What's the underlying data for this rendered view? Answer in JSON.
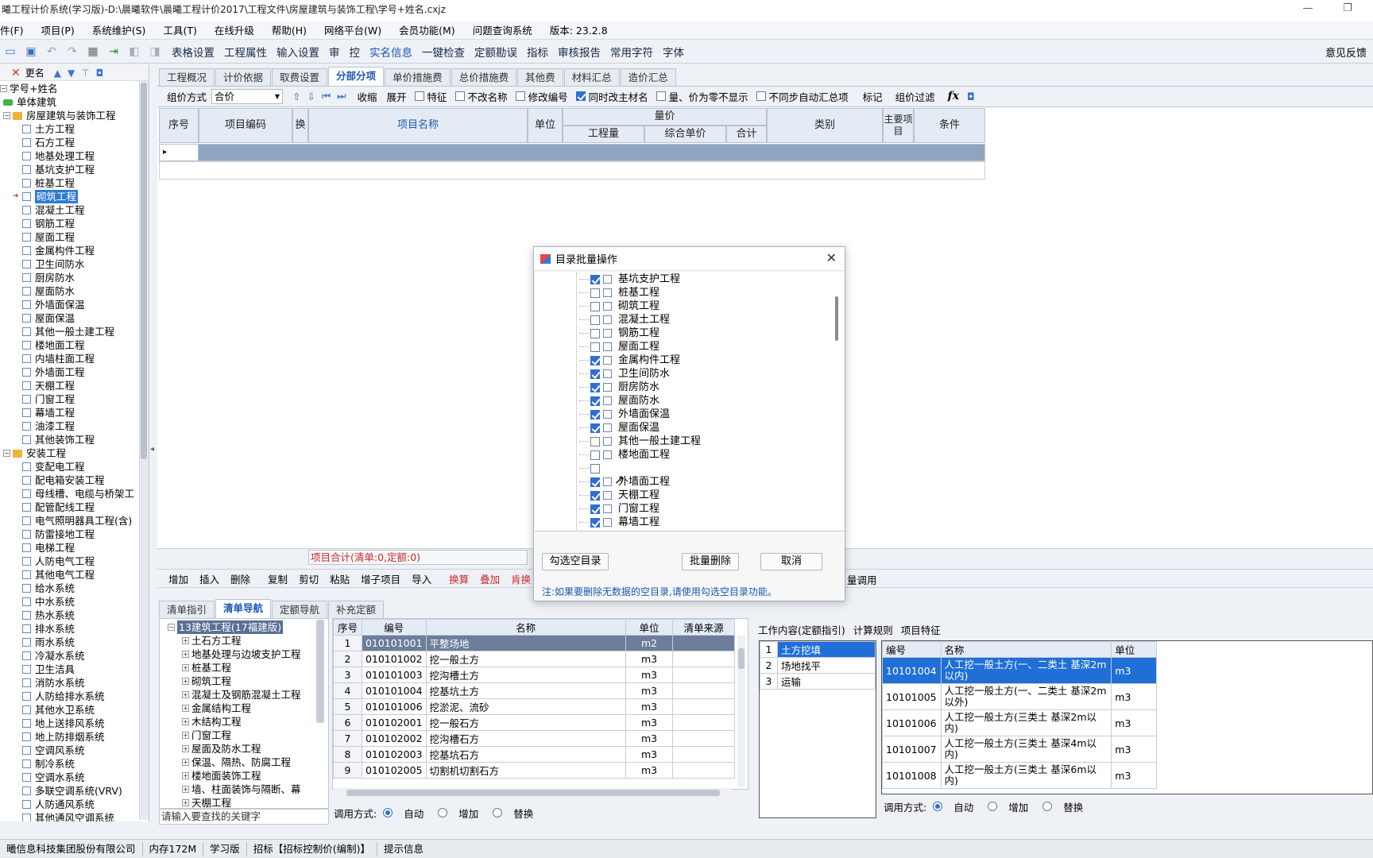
{
  "title": "曦工程计价系统(学习版)-D:\\晨曦软件\\晨曦工程计价2017\\工程文件\\房屋建筑与装饰工程\\学号+姓名.cxjz",
  "menu": [
    "件(F)",
    "项目(P)",
    "系统维护(S)",
    "工具(T)",
    "在线升级",
    "帮助(H)",
    "网络平台(W)",
    "会员功能(M)",
    "问题查询系统",
    "版本: 23.2.8"
  ],
  "toolbar": [
    "表格设置",
    "工程属性",
    "输入设置",
    "审",
    "控",
    "实名信息",
    "一键检查",
    "定额勘误",
    "指标",
    "审核报告",
    "常用字符",
    "字体"
  ],
  "feedback": "意见反馈",
  "tree": {
    "rename": "更名",
    "root": "学号+姓名",
    "unit": "单体建筑",
    "g1": "房屋建筑与装饰工程",
    "g1_items": [
      "土方工程",
      "石方工程",
      "地基处理工程",
      "基坑支护工程",
      "桩基工程",
      "砌筑工程",
      "混凝土工程",
      "钢筋工程",
      "屋面工程",
      "金属构件工程",
      "卫生间防水",
      "厨房防水",
      "屋面防水",
      "外墙面保温",
      "屋面保温",
      "其他一般土建工程",
      "楼地面工程",
      "内墙柱面工程",
      "外墙面工程",
      "天棚工程",
      "门窗工程",
      "幕墙工程",
      "油漆工程",
      "其他装饰工程"
    ],
    "g2": "安装工程",
    "g2_items": [
      "变配电工程",
      "配电箱安装工程",
      "母线槽、电缆与桥架工",
      "配管配线工程",
      "电气照明器具工程(含)",
      "防雷接地工程",
      "电梯工程",
      "人防电气工程",
      "其他电气工程",
      "给水系统",
      "中水系统",
      "热水系统",
      "排水系统",
      "雨水系统",
      "冷凝水系统",
      "卫生洁具",
      "消防水系统",
      "人防给排水系统",
      "其他水卫系统",
      "地上送排风系统",
      "地上防排烟系统",
      "空调风系统",
      "制冷系统",
      "空调水系统",
      "多联空调系统(VRV)",
      "人防通风系统",
      "其他通风空调系统"
    ]
  },
  "tabs": [
    "工程概况",
    "计价依据",
    "取费设置",
    "分部分项",
    "单价措施费",
    "总价措施费",
    "其他费",
    "材料汇总",
    "造价汇总"
  ],
  "subbar": {
    "method_label": "组价方式",
    "method_value": "合价",
    "collapse": "收缩",
    "expand": "展开",
    "cb1": "特征",
    "cb2": "不改名称",
    "cb3": "修改编号",
    "cb4": "同时改主材名",
    "cb5": "量、价为零不显示",
    "cb6": "不同步自动汇总项",
    "mark": "标记",
    "filter": "组价过滤",
    "fx": "fx"
  },
  "grid": {
    "seq": "序号",
    "code": "项目编码",
    "swap": "换",
    "name": "项目名称",
    "unit": "单位",
    "qty_group": "量价",
    "qty": "工程量",
    "price": "综合单价",
    "total": "合计",
    "cat": "类别",
    "main": "主要项目",
    "cond": "条件"
  },
  "summary": "项目合计(清单:0,定额:0)",
  "actions": [
    "增加",
    "插入",
    "删除",
    "复制",
    "剪切",
    "粘贴",
    "增子项目",
    "导入",
    "换算",
    "叠加",
    "肯换"
  ],
  "actions_right": "量调用",
  "dialog": {
    "title": "目录批量操作",
    "items": [
      {
        "label": "基坑支护工程",
        "checked": true
      },
      {
        "label": "桩基工程",
        "checked": false
      },
      {
        "label": "砌筑工程",
        "checked": false
      },
      {
        "label": "混凝土工程",
        "checked": false
      },
      {
        "label": "钢筋工程",
        "checked": false
      },
      {
        "label": "屋面工程",
        "checked": false
      },
      {
        "label": "金属构件工程",
        "checked": true
      },
      {
        "label": "卫生间防水",
        "checked": true
      },
      {
        "label": "厨房防水",
        "checked": true
      },
      {
        "label": "屋面防水",
        "checked": true
      },
      {
        "label": "外墙面保温",
        "checked": true
      },
      {
        "label": "屋面保温",
        "checked": true
      },
      {
        "label": "其他一般土建工程",
        "checked": false
      },
      {
        "label": "楼地面工程",
        "checked": false
      },
      {
        "label": "",
        "checked": false
      },
      {
        "label": "外墙面工程",
        "checked": true
      },
      {
        "label": "天棚工程",
        "checked": true
      },
      {
        "label": "门窗工程",
        "checked": true
      },
      {
        "label": "幕墙工程",
        "checked": true
      }
    ],
    "btn_select_empty": "勾选空目录",
    "btn_delete": "批量删除",
    "btn_cancel": "取消",
    "note": "注:如果要删除无数据的空目录,请使用勾选空目录功能。"
  },
  "bottom_tabs": [
    "清单指引",
    "清单导航",
    "定额导航",
    "补充定额"
  ],
  "nav_tree": {
    "root": "13建筑工程(17福建版)",
    "items": [
      "土石方工程",
      "地基处理与边坡支护工程",
      "桩基工程",
      "砌筑工程",
      "混凝土及钢筋混凝土工程",
      "金属结构工程",
      "木结构工程",
      "门窗工程",
      "屋面及防水工程",
      "保温、隔热、防腐工程",
      "楼地面装饰工程",
      "墙、柱面装饰与隔断、幕",
      "天棚工程"
    ],
    "search_placeholder": "请输入要查找的关键字"
  },
  "list": {
    "headers": [
      "序号",
      "编号",
      "名称",
      "单位",
      "清单来源"
    ],
    "rows": [
      [
        "1",
        "010101001",
        "平整场地",
        "m2"
      ],
      [
        "2",
        "010101002",
        "挖一般土方",
        "m3"
      ],
      [
        "3",
        "010101003",
        "挖沟槽土方",
        "m3"
      ],
      [
        "4",
        "010101004",
        "挖基坑土方",
        "m3"
      ],
      [
        "5",
        "010101006",
        "挖淤泥、流砂",
        "m3"
      ],
      [
        "6",
        "010102001",
        "挖一般石方",
        "m3"
      ],
      [
        "7",
        "010102002",
        "挖沟槽石方",
        "m3"
      ],
      [
        "8",
        "010102003",
        "挖基坑石方",
        "m3"
      ],
      [
        "9",
        "010102005",
        "切割机切割石方",
        "m3"
      ]
    ],
    "call_label": "调用方式:",
    "opt_auto": "自动",
    "opt_add": "增加",
    "opt_replace": "替换"
  },
  "work": {
    "tabs": [
      "工作内容(定额指引)",
      "计算规则",
      "项目特征"
    ],
    "steps": [
      [
        "1",
        "土方挖填"
      ],
      [
        "2",
        "场地找平"
      ],
      [
        "3",
        "运输"
      ]
    ],
    "headers": [
      "编号",
      "名称",
      "单位"
    ],
    "rows": [
      [
        "10101004",
        "人工挖一般土方(一、二类土 基深2m以内)",
        "m3"
      ],
      [
        "10101005",
        "人工挖一般土方(一、二类土 基深2m以外)",
        "m3"
      ],
      [
        "10101006",
        "人工挖一般土方(三类土 基深2m以内)",
        "m3"
      ],
      [
        "10101007",
        "人工挖一般土方(三类土 基深4m以内)",
        "m3"
      ],
      [
        "10101008",
        "人工挖一般土方(三类土 基深6m以内)",
        "m3"
      ]
    ],
    "call_label": "调用方式:",
    "opt_auto": "自动",
    "opt_add": "增加",
    "opt_replace": "替换"
  },
  "status": [
    "曦信息科技集团股份有限公司",
    "内存172M",
    "学习版",
    "招标【招标控制价(编制)】",
    "提示信息"
  ]
}
